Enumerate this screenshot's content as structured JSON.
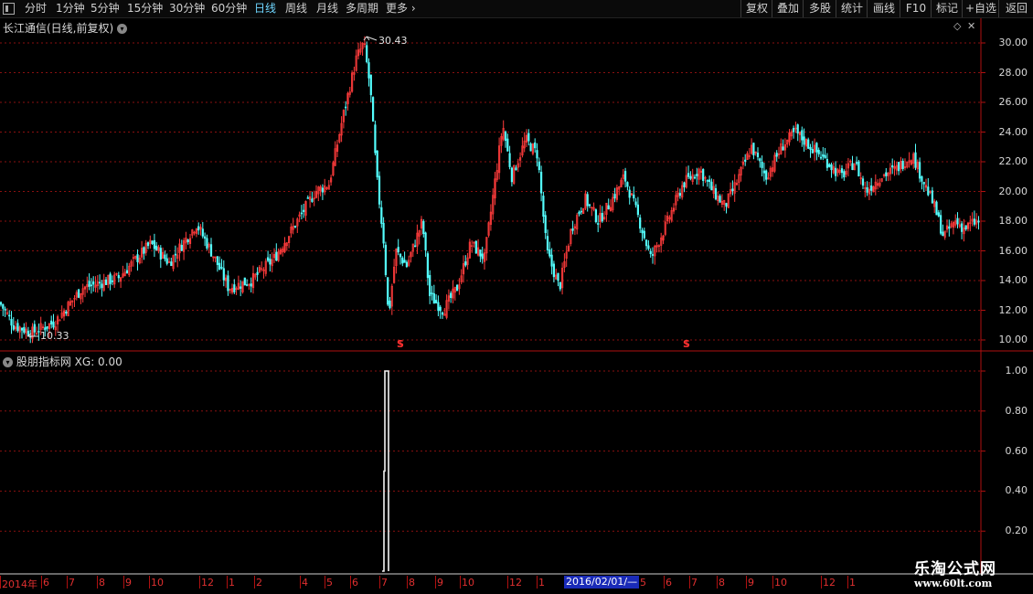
{
  "toolbar": {
    "periods": [
      "分时",
      "1分钟",
      "5分钟",
      "15分钟",
      "30分钟",
      "60分钟",
      "日线",
      "周线",
      "月线",
      "多周期",
      "更多"
    ],
    "active_period": "日线",
    "right_buttons": [
      "复权",
      "叠加",
      "多股",
      "统计",
      "画线",
      "F10",
      "标记",
      "+自选",
      "返回"
    ]
  },
  "main_panel": {
    "title": "长江通信(日线,前复权)",
    "y_labels": [
      "30.00",
      "28.00",
      "26.00",
      "24.00",
      "22.00",
      "20.00",
      "18.00",
      "16.00",
      "14.00",
      "12.00",
      "10.00"
    ],
    "high_label": "30.43",
    "low_label": "10.33",
    "signal_marker": "S"
  },
  "indicator_panel": {
    "title": "股朋指标网",
    "value_text": "XG: 0.00",
    "y_labels": [
      "1.00",
      "0.80",
      "0.60",
      "0.40",
      "0.20"
    ]
  },
  "date_axis": {
    "labels": [
      "2014年",
      "6",
      "7",
      "8",
      "9",
      "10",
      "12",
      "1",
      "2",
      "4",
      "5",
      "6",
      "7",
      "8",
      "9",
      "10",
      "12",
      "1",
      "5",
      "6",
      "7",
      "8",
      "9",
      "10",
      "12",
      "1"
    ],
    "cursor_date": "2016/02/01/—"
  },
  "watermark": {
    "title": "乐淘公式网",
    "url": "www.60lt.com"
  },
  "colors": {
    "up": "#ff3b3b",
    "down": "#54ffff",
    "axis": "#b01010",
    "grid": "#8a1010",
    "active": "#6fd6ff"
  }
}
